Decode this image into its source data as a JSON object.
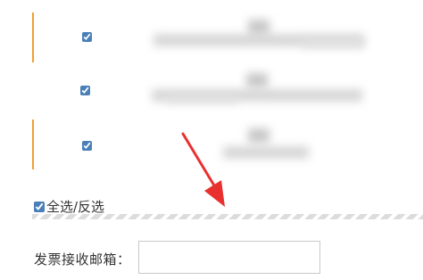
{
  "colors": {
    "accent": "#f0a030",
    "checkbox": "#4a7fb8",
    "annotation_arrow": "#e8312f"
  },
  "rows": [
    {
      "checked": true,
      "accent": true
    },
    {
      "checked": true,
      "accent": false
    },
    {
      "checked": true,
      "accent": true
    }
  ],
  "select_all": {
    "label": "全选/反选",
    "checked": true
  },
  "email": {
    "label": "发票接收邮箱：",
    "value": "",
    "placeholder": ""
  },
  "icons": {
    "annotation": "red-arrow-icon"
  }
}
